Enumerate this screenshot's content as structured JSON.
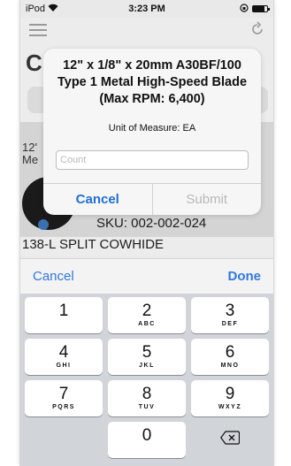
{
  "status_bar": {
    "device": "iPod",
    "time": "3:23 PM"
  },
  "background": {
    "title_initial": "C",
    "row_text_line1": "12'",
    "row_text_line2": "Me",
    "sku": "SKU: 002-002-024",
    "product_name": "138-L  SPLIT COWHIDE"
  },
  "alert": {
    "title": "12\" x 1/8\" x 20mm A30BF/100 Type 1 Metal High-Speed Blade (Max RPM: 6,400)",
    "message": "Unit of Measure: EA",
    "input_placeholder": "Count",
    "input_value": "",
    "cancel_label": "Cancel",
    "submit_label": "Submit"
  },
  "keyboard_toolbar": {
    "cancel_label": "Cancel",
    "done_label": "Done"
  },
  "keypad": {
    "rows": [
      [
        {
          "digit": "1",
          "letters": ""
        },
        {
          "digit": "2",
          "letters": "ABC"
        },
        {
          "digit": "3",
          "letters": "DEF"
        }
      ],
      [
        {
          "digit": "4",
          "letters": "GHI"
        },
        {
          "digit": "5",
          "letters": "JKL"
        },
        {
          "digit": "6",
          "letters": "MNO"
        }
      ],
      [
        {
          "digit": "7",
          "letters": "PQRS"
        },
        {
          "digit": "8",
          "letters": "TUV"
        },
        {
          "digit": "9",
          "letters": "WXYZ"
        }
      ]
    ],
    "zero": "0",
    "delete_icon": "backspace-icon"
  },
  "colors": {
    "accent": "#2f79e0",
    "dialog_cancel": "#1f6fd6",
    "disabled": "#b9b9b9",
    "keypad_bg": "#d1d4d9"
  }
}
